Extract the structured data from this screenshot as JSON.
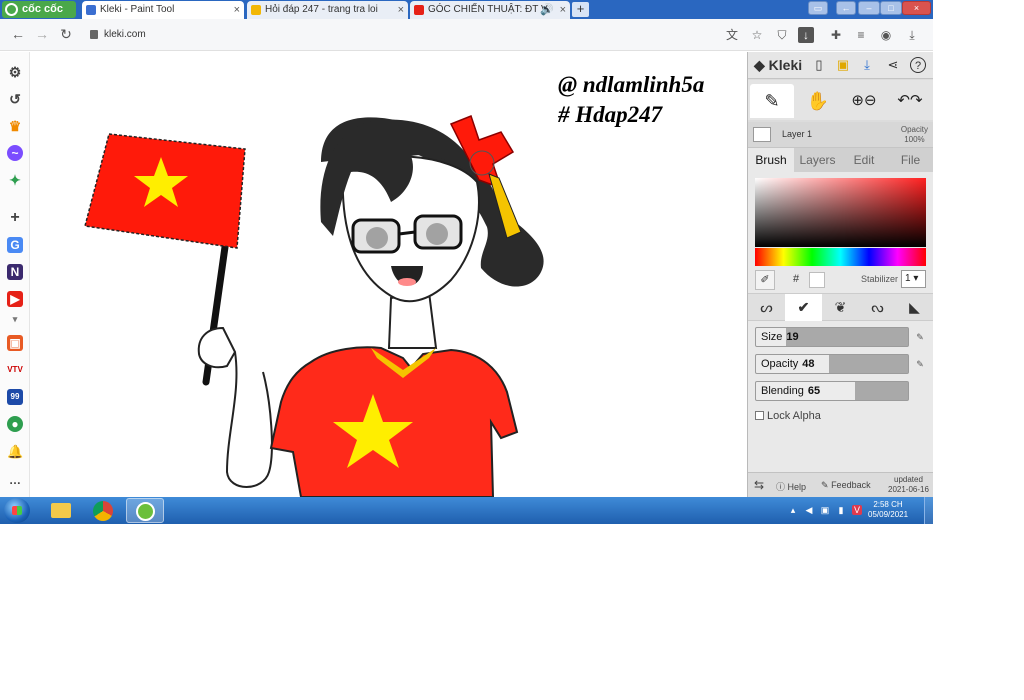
{
  "browser": {
    "brand": "cốc cốc",
    "tabs": [
      {
        "title": "Kleki - Paint Tool",
        "active": true
      },
      {
        "title": "Hỏi đáp 247 - trang tra loi",
        "active": false
      },
      {
        "title": "GÓC CHIẾN THUẬT: ĐT V",
        "active": false
      }
    ],
    "url": "kleki.com"
  },
  "canvas": {
    "watermark_line1": "@ ndlamlinh5a",
    "watermark_line2": "# Hdap247",
    "colors": {
      "flag_red": "#ff1a0a",
      "star_yellow": "#ffee00",
      "shirt_red": "#ff2a1a",
      "hair": "#2a2a2a"
    }
  },
  "kleki": {
    "logo": "Kleki",
    "layer": {
      "name": "Layer 1",
      "opacity_label": "Opacity",
      "opacity_value": "100%"
    },
    "tabs": [
      "Brush",
      "Layers",
      "Edit",
      "File"
    ],
    "active_tab": "Brush",
    "hash_symbol": "#",
    "stabilizer_label": "Stabilizer",
    "stabilizer_value": "1",
    "sliders": [
      {
        "label": "Size",
        "value": "19",
        "fraction": 0.2
      },
      {
        "label": "Opacity",
        "value": "48",
        "fraction": 0.48
      },
      {
        "label": "Blending",
        "value": "65",
        "fraction": 0.65
      }
    ],
    "lock_alpha": "Lock Alpha",
    "footer": {
      "help": "Help",
      "feedback": "Feedback",
      "updated_label": "updated",
      "updated_date": "2021-06-16"
    }
  },
  "taskbar": {
    "time": "2:58 CH",
    "date": "05/09/2021"
  }
}
